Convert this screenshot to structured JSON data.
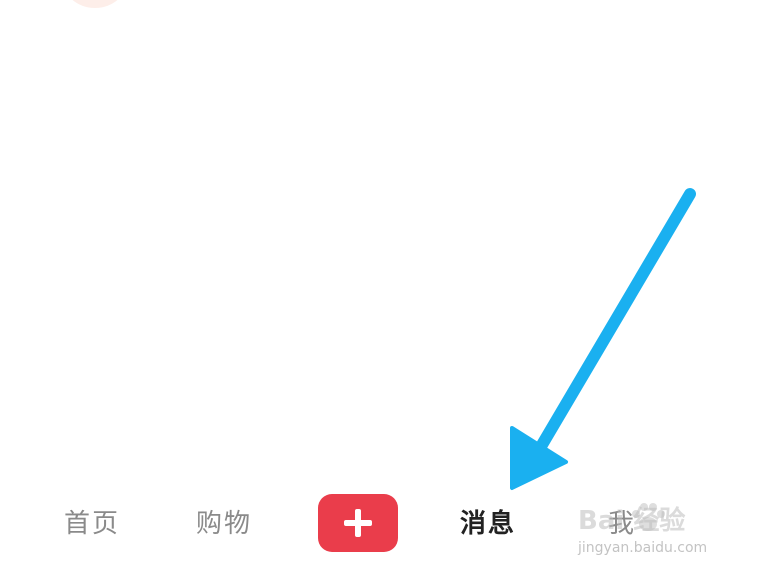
{
  "tabbar": {
    "home_label": "首页",
    "shop_label": "购物",
    "messages_label": "消息",
    "me_label": "我"
  },
  "colors": {
    "plus_button": "#ea3d4b",
    "active_tab_text": "#222222",
    "inactive_tab_text": "#8a8a8a",
    "annotation_arrow": "#1ab0f0"
  },
  "watermark": {
    "logo_text": "Bai 经验",
    "url": "jingyan.baidu.com"
  }
}
